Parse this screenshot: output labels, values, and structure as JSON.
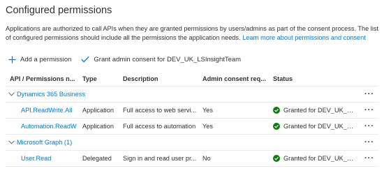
{
  "page": {
    "title": "Configured permissions",
    "description": "Applications are authorized to call APIs when they are granted permissions by users/admins as part of the consent process. The list of configured permissions should include all the permissions the application needs.",
    "learn_more": "Learn more about permissions and consent"
  },
  "toolbar": {
    "add_permission": "Add a permission",
    "grant_consent": "Grant admin consent for DEV_UK_LSInsightTeam"
  },
  "table": {
    "headers": {
      "api": "API / Permissions n...",
      "type": "Type",
      "description": "Description",
      "admin": "Admin consent req...",
      "status": "Status"
    },
    "groups": [
      {
        "label": "Dynamics 365 Business",
        "rows": [
          {
            "name": "API.ReadWrite.All",
            "type": "Application",
            "description": "Full access to web servi...",
            "admin": "Yes",
            "status": "Granted for DEV_UK_LSI..."
          },
          {
            "name": "Automation.ReadW",
            "type": "Application",
            "description": "Full access to automation",
            "admin": "Yes",
            "status": "Granted for DEV_UK_LSI..."
          }
        ]
      },
      {
        "label": "Microsoft Graph (1)",
        "rows": [
          {
            "name": "User.Read",
            "type": "Delegated",
            "description": "Sign in and read user pr...",
            "admin": "No",
            "status": "Granted for DEV_UK_LSI..."
          }
        ]
      }
    ],
    "more_glyph": "···"
  },
  "colors": {
    "link": "#0078d4",
    "success": "#107c10",
    "text": "#323130",
    "divider": "#edebe9"
  },
  "icons": {
    "add": "plus-icon",
    "grant": "checkmark-icon",
    "expand": "chevron-down-icon",
    "status": "success-check-icon",
    "more": "more-icon"
  }
}
